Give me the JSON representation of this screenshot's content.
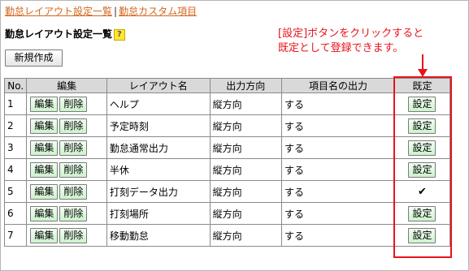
{
  "breadcrumb": {
    "link1": "勤怠レイアウト設定一覧",
    "separator": "|",
    "link2": "勤怠カスタム項目"
  },
  "page": {
    "title": "勤怠レイアウト設定一覧",
    "help_badge": "?",
    "new_button": "新規作成"
  },
  "annotation": {
    "line1": "[設定]ボタンをクリックすると",
    "line2": "既定として登録できます。",
    "color": "#e8131b"
  },
  "table": {
    "headers": {
      "no": "No.",
      "edit": "編集",
      "layout_name": "レイアウト名",
      "output_direction": "出力方向",
      "item_name_output": "項目名の出力",
      "default": "既定"
    },
    "edit_label": "編集",
    "delete_label": "削除",
    "set_label": "設定",
    "check_mark": "✔",
    "rows": [
      {
        "no": "1",
        "name": "ヘルプ",
        "direction": "縦方向",
        "output": "する",
        "is_default": false
      },
      {
        "no": "2",
        "name": "予定時刻",
        "direction": "縦方向",
        "output": "する",
        "is_default": false
      },
      {
        "no": "3",
        "name": "勤怠通常出力",
        "direction": "縦方向",
        "output": "する",
        "is_default": false
      },
      {
        "no": "4",
        "name": "半休",
        "direction": "縦方向",
        "output": "する",
        "is_default": false
      },
      {
        "no": "5",
        "name": "打刻データ出力",
        "direction": "縦方向",
        "output": "する",
        "is_default": true
      },
      {
        "no": "6",
        "name": "打刻場所",
        "direction": "縦方向",
        "output": "する",
        "is_default": false
      },
      {
        "no": "7",
        "name": "移動勤怠",
        "direction": "縦方向",
        "output": "する",
        "is_default": false
      }
    ]
  }
}
